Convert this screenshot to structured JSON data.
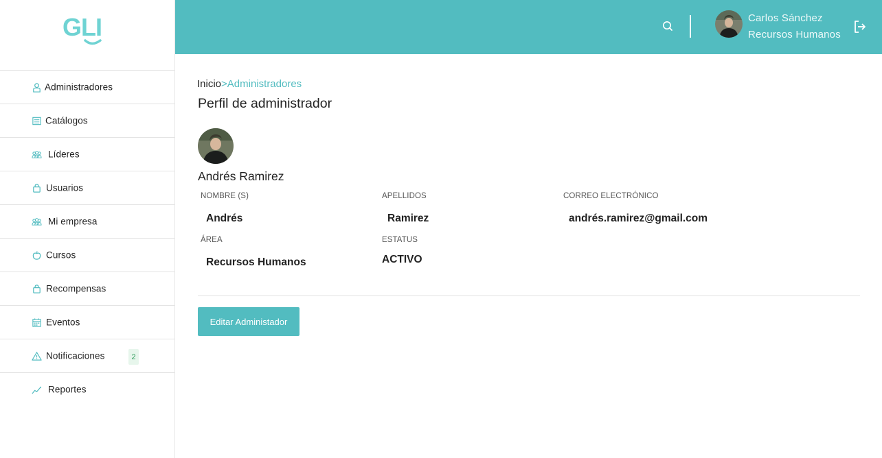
{
  "brand": {
    "logo_text": "GLI",
    "accent_color": "#52bcc0"
  },
  "sidebar": {
    "items": [
      {
        "label": "Administradores",
        "icon": "user-icon"
      },
      {
        "label": "Catálogos",
        "icon": "list-icon"
      },
      {
        "label": "Líderes",
        "icon": "group-icon"
      },
      {
        "label": "Usuarios",
        "icon": "bag-icon"
      },
      {
        "label": "Mi empresa",
        "icon": "group-icon"
      },
      {
        "label": "Cursos",
        "icon": "apple-icon"
      },
      {
        "label": "Recompensas",
        "icon": "bag-icon"
      },
      {
        "label": "Eventos",
        "icon": "calendar-icon"
      },
      {
        "label": "Notificaciones",
        "icon": "alert-icon",
        "badge": "2"
      },
      {
        "label": "Reportes",
        "icon": "chart-line-icon"
      }
    ]
  },
  "topbar": {
    "user_name": "Carlos Sánchez",
    "user_role": "Recursos Humanos"
  },
  "breadcrumb": {
    "home": "Inicio",
    "separator": ">",
    "current": "Administradores"
  },
  "page_title": "Perfil de administrador",
  "profile": {
    "full_name": "Andrés Ramirez",
    "fields": {
      "nombre_label": "NOMBRE (S)",
      "nombre_value": "Andrés",
      "apellidos_label": "APELLIDOS",
      "apellidos_value": "Ramirez",
      "correo_label": "CORREO ELECTRÓNICO",
      "correo_value": "andrés.ramirez@gmail.com",
      "area_label": "ÁREA",
      "area_value": "Recursos Humanos",
      "estatus_label": "ESTATUS",
      "estatus_value": "ACTIVO"
    }
  },
  "actions": {
    "edit_label": "Editar Administador"
  }
}
